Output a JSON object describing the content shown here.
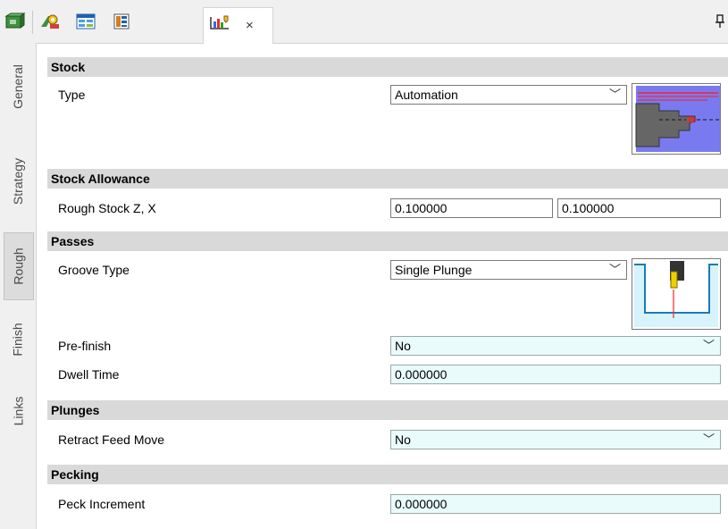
{
  "toolbar": {
    "buttons": [
      "stock-model-icon",
      "tool-settings-icon",
      "toolpath-table-icon",
      "document-icon"
    ],
    "active_tab_icon": "roughing-toolpath-icon",
    "close_label": "×",
    "pin_icon": "pin-icon"
  },
  "side_tabs": [
    {
      "label": "General",
      "active": false
    },
    {
      "label": "Strategy",
      "active": false
    },
    {
      "label": "Rough",
      "active": true
    },
    {
      "label": "Finish",
      "active": false
    },
    {
      "label": "Links",
      "active": false
    }
  ],
  "sections": {
    "stock": {
      "title": "Stock",
      "type_label": "Type",
      "type_value": "Automation"
    },
    "allowance": {
      "title": "Stock Allowance",
      "rough_label": "Rough Stock Z, X",
      "rough_z": "0.100000",
      "rough_x": "0.100000"
    },
    "passes": {
      "title": "Passes",
      "groove_label": "Groove Type",
      "groove_value": "Single Plunge",
      "prefinish_label": "Pre-finish",
      "prefinish_value": "No",
      "dwell_label": "Dwell Time",
      "dwell_value": "0.000000"
    },
    "plunges": {
      "title": "Plunges",
      "retract_label": "Retract Feed Move",
      "retract_value": "No"
    },
    "pecking": {
      "title": "Pecking",
      "peck_label": "Peck Increment",
      "peck_value": "0.000000"
    }
  },
  "colors": {
    "editable_bg": "#e9fbfb",
    "section_bg": "#d9d9d9",
    "stock_blue": "#7a7af0",
    "groove_cyan": "#d7f3fb"
  }
}
